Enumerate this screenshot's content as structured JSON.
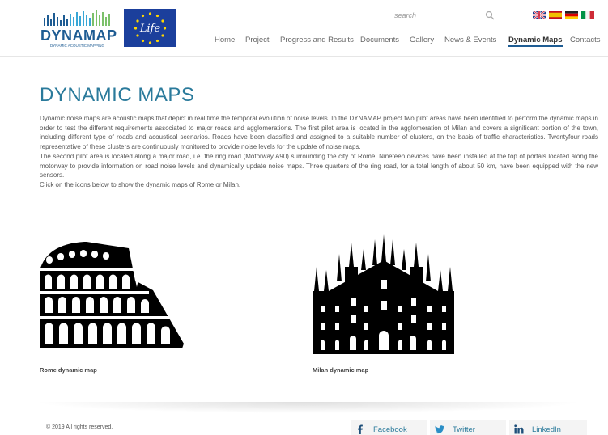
{
  "brand": {
    "name": "DYNAMAP",
    "tagline": "DYNAMIC ACOUSTIC MAPPING",
    "partner_logo_text": "Life",
    "colors": {
      "primary": "#1e5c93",
      "accent": "#2a7a9b",
      "life_blue": "#1b3f9c"
    }
  },
  "search": {
    "placeholder": "search",
    "icon": "search-icon"
  },
  "languages": [
    {
      "code": "en",
      "icon": "flag-uk-icon"
    },
    {
      "code": "es",
      "icon": "flag-es-icon"
    },
    {
      "code": "de",
      "icon": "flag-de-icon"
    },
    {
      "code": "it",
      "icon": "flag-it-icon"
    }
  ],
  "nav": {
    "items": [
      {
        "label": "Home"
      },
      {
        "label": "Project"
      },
      {
        "label": "Progress and Results"
      },
      {
        "label": "Documents"
      },
      {
        "label": "Gallery"
      },
      {
        "label": "News & Events"
      },
      {
        "label": "Dynamic Maps",
        "active": true
      },
      {
        "label": "Contacts"
      }
    ]
  },
  "main": {
    "title": "DYNAMIC MAPS",
    "paragraphs": [
      "Dynamic noise maps are acoustic maps that depict in real time the temporal evolution of noise levels. In the DYNAMAP project two pilot areas have been identified to perform the dynamic maps in order to test the different requirements associated to major roads and agglomerations. The first pilot area is located in the agglomeration of Milan and covers a significant portion of the town, including different type of roads and acoustical scenarios. Roads have been classified and assigned to a suitable number of clusters, on the basis of traffic characteristics. Twentyfour roads representative of these clusters are continuously monitored to provide noise levels for the update of noise maps.",
      "The second pilot area is located along a major road, i.e. the ring road (Motorway A90) surrounding the city of Rome. Nineteen devices have been installed at the top of portals located along the motorway to provide information on road noise levels and dynamically update noise maps. Three quarters of the ring road, for a total length of about 50 km, have been equipped with the new sensors.",
      "Click on the icons below to show the dynamic maps of Rome or Milan."
    ],
    "cards": [
      {
        "label": "Rome dynamic map",
        "icon": "colosseum-icon"
      },
      {
        "label": "Milan dynamic map",
        "icon": "milan-cathedral-icon"
      }
    ]
  },
  "footer": {
    "copyright": "© 2019 All rights reserved.",
    "social": [
      {
        "label": "Facebook",
        "icon": "facebook-icon"
      },
      {
        "label": "Twitter",
        "icon": "twitter-icon"
      },
      {
        "label": "LinkedIn",
        "icon": "linkedin-icon"
      }
    ]
  }
}
